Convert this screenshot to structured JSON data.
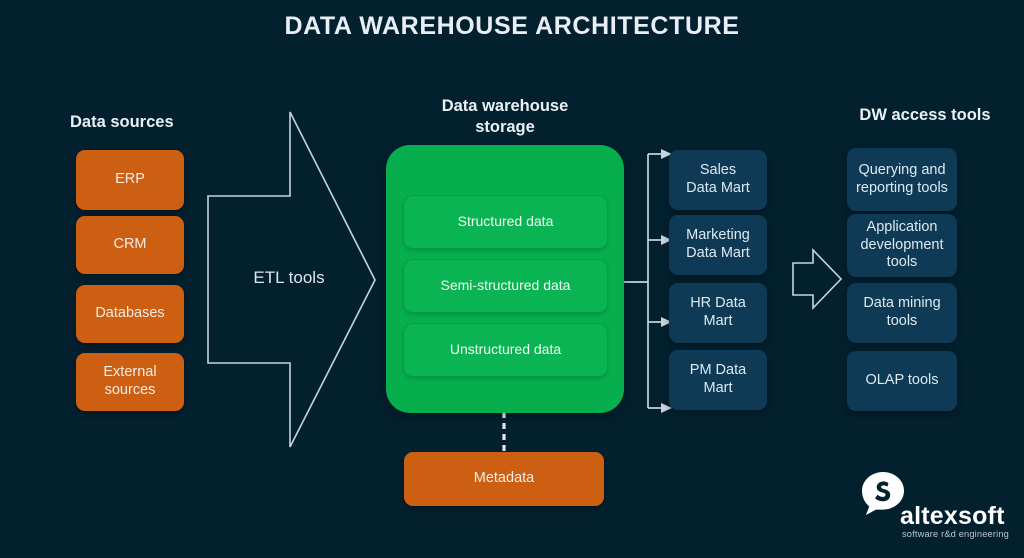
{
  "page": {
    "title": "DATA WAREHOUSE ARCHITECTURE",
    "background_color": "#03202f"
  },
  "colors": {
    "background": "#03202f",
    "source_orange": "#cc5f12",
    "warehouse_green": "#07ae4e",
    "warehouse_inner_green": "#0bb453",
    "card_navy": "#0e3a55",
    "line": "#c7d4de",
    "text": "#e8eef4"
  },
  "columns": {
    "data_sources": {
      "heading": "Data sources",
      "items": [
        {
          "label": "ERP"
        },
        {
          "label": "CRM"
        },
        {
          "label": "Databases"
        },
        {
          "label": "External sources"
        }
      ]
    },
    "etl": {
      "label": "ETL tools",
      "shape": "right-arrow-outline"
    },
    "warehouse": {
      "heading": "Data warehouse storage",
      "heading_line1": "Data warehouse",
      "heading_line2": "storage",
      "layers": [
        {
          "label": "Structured data"
        },
        {
          "label": "Semi-structured data"
        },
        {
          "label": "Unstructured data"
        }
      ]
    },
    "metadata": {
      "label": "Metadata",
      "connector": "dashed-vertical"
    },
    "data_marts": {
      "items": [
        {
          "label": "Sales Data Mart",
          "line1": "Sales",
          "line2": "Data Mart"
        },
        {
          "label": "Marketing Data Mart",
          "line1": "Marketing",
          "line2": "Data Mart"
        },
        {
          "label": "HR Data Mart",
          "line1": "HR Data",
          "line2": "Mart"
        },
        {
          "label": "PM Data Mart",
          "line1": "PM Data",
          "line2": "Mart"
        }
      ]
    },
    "access_arrow": {
      "shape": "right-arrow-outline"
    },
    "dw_access_tools": {
      "heading": "DW access tools",
      "items": [
        {
          "label": "Querying and reporting tools"
        },
        {
          "label": "Application development tools"
        },
        {
          "label": "Data mining tools"
        },
        {
          "label": "OLAP tools"
        }
      ]
    }
  },
  "logo": {
    "name": "altexsoft",
    "tagline": "software r&d engineering",
    "mark": "speech-bubble-s"
  }
}
